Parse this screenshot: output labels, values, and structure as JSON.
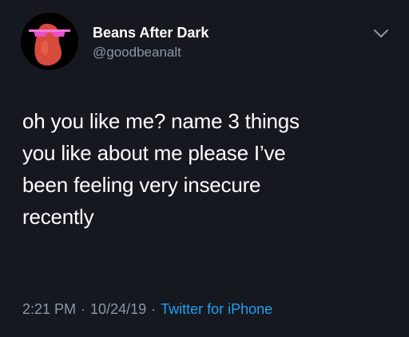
{
  "colors": {
    "background": "#15181f",
    "text": "#ffffff",
    "secondary": "#8b98a5",
    "link": "#1da1f2",
    "avatar_bean": "#d84a3c",
    "avatar_glasses": "#e84fc8"
  },
  "author": {
    "display_name": "Beans After Dark",
    "handle": "@goodbeanalt",
    "avatar_icon": "bean-with-sunglasses-avatar"
  },
  "menu_icon": "chevron-down-icon",
  "tweet": {
    "lines": [
      "oh you like me? name 3 things",
      "you like about me please I’ve",
      "been feeling very insecure",
      "recently"
    ]
  },
  "meta": {
    "time": "2:21 PM",
    "date": "10/24/19",
    "separator": "·",
    "source": "Twitter for iPhone"
  }
}
